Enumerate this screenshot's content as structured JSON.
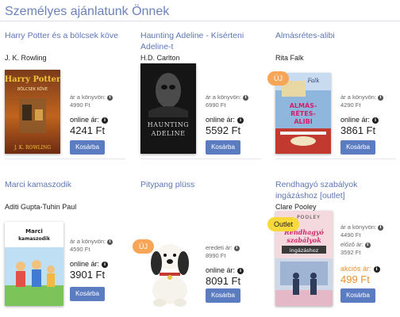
{
  "section": {
    "title": "Személyes ajánlatunk Önnek"
  },
  "labels": {
    "book_price": "ár a könyvön:",
    "original_price": "eredeti ár:",
    "online_price": "online ár:",
    "previous_price": "előző ár:",
    "sale_price": "akciós ár:",
    "cart_button": "Kosárba",
    "badge_new": "ÚJ",
    "badge_outlet": "Outlet"
  },
  "products": [
    {
      "title": "Harry Potter és a bölcsek köve",
      "author": "J. K. Rowling",
      "list_price": "4990 Ft",
      "online_price": "4241 Ft",
      "cover_text": [
        "Harry Potter",
        "BÖLCSEK KÖVE",
        "J. K. ROWLING"
      ]
    },
    {
      "title": "Haunting Adeline - Kísérteni Adeline-t",
      "author": "H.D. Carlton",
      "list_price": "6990 Ft",
      "online_price": "5592 Ft",
      "cover_text": [
        "HAUNTING",
        "ADELINE"
      ]
    },
    {
      "title": "Almásrétes-alibi",
      "author": "Rita Falk",
      "list_price": "4290 Ft",
      "online_price": "3861 Ft",
      "badge": "ÚJ",
      "cover_text": [
        "Falk",
        "ALMÁS-",
        "RÉTES-",
        "ALIBI"
      ]
    },
    {
      "title": "Marci kamaszodik",
      "author": "Aditi Gupta-Tuhin Paul",
      "list_price": "4590 Ft",
      "online_price": "3901 Ft",
      "cover_text": [
        "Marci",
        "kamaszodik"
      ]
    },
    {
      "title": "Pitypang plüss",
      "author": "",
      "original_price": "8990 Ft",
      "online_price": "8091 Ft",
      "badge": "ÚJ"
    },
    {
      "title": "Rendhagyó szabályok ingázáshoz [outlet]",
      "author": "Clare Pooley",
      "list_price": "4490 Ft",
      "previous_price": "3592 Ft",
      "sale_price": "499 Ft",
      "badge": "Outlet",
      "cover_text": [
        "POOLEY",
        "Rendhagyó",
        "szabályok",
        "ingázáshoz"
      ]
    }
  ],
  "colors": {
    "link": "#5d76b5",
    "button": "#5c7cc2",
    "badge_new": "#f7a556",
    "badge_outlet": "#f8d93c",
    "sale_price": "#e8912e"
  }
}
